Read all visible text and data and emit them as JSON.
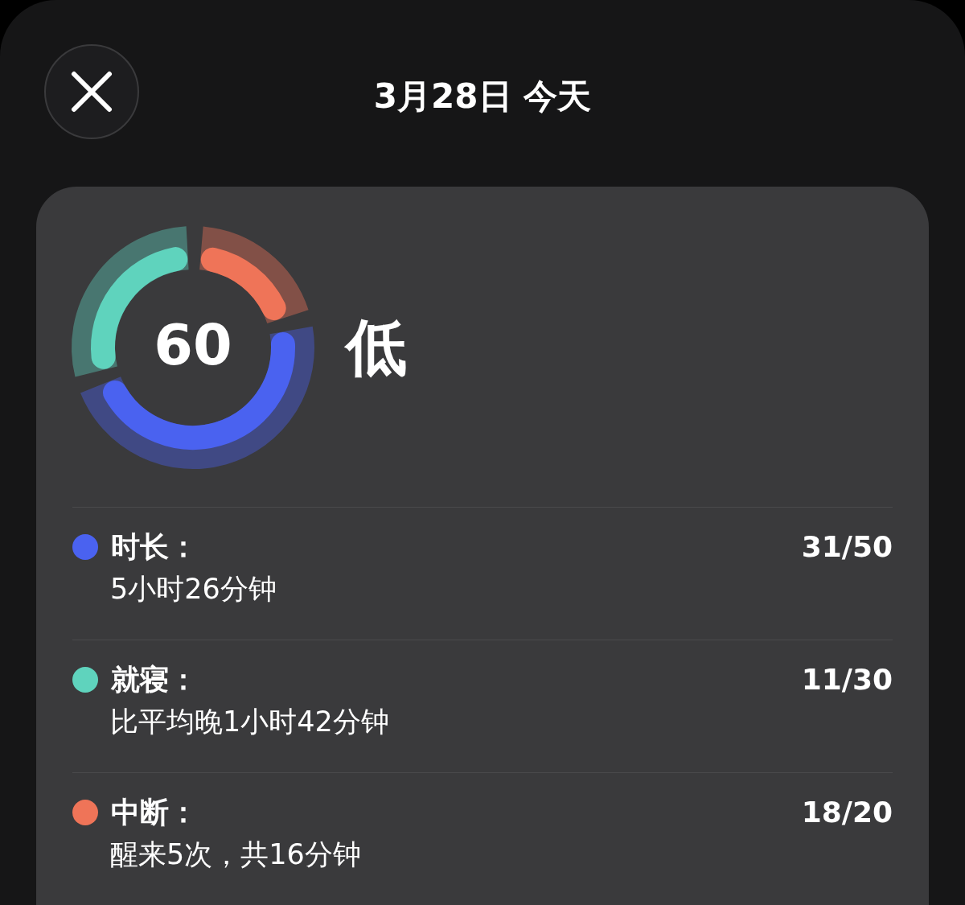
{
  "header": {
    "title": "3月28日 今天"
  },
  "summary": {
    "score": "60",
    "rating": "低"
  },
  "metrics": [
    {
      "name": "时长：",
      "color": "#4a62f0",
      "score": "31/50",
      "detail": "5小时26分钟"
    },
    {
      "name": "就寝：",
      "color": "#5fd3bd",
      "score": "11/30",
      "detail": "比平均晚1小时42分钟"
    },
    {
      "name": "中断：",
      "color": "#ef7458",
      "score": "18/20",
      "detail": "醒来5次，共16分钟"
    }
  ]
}
